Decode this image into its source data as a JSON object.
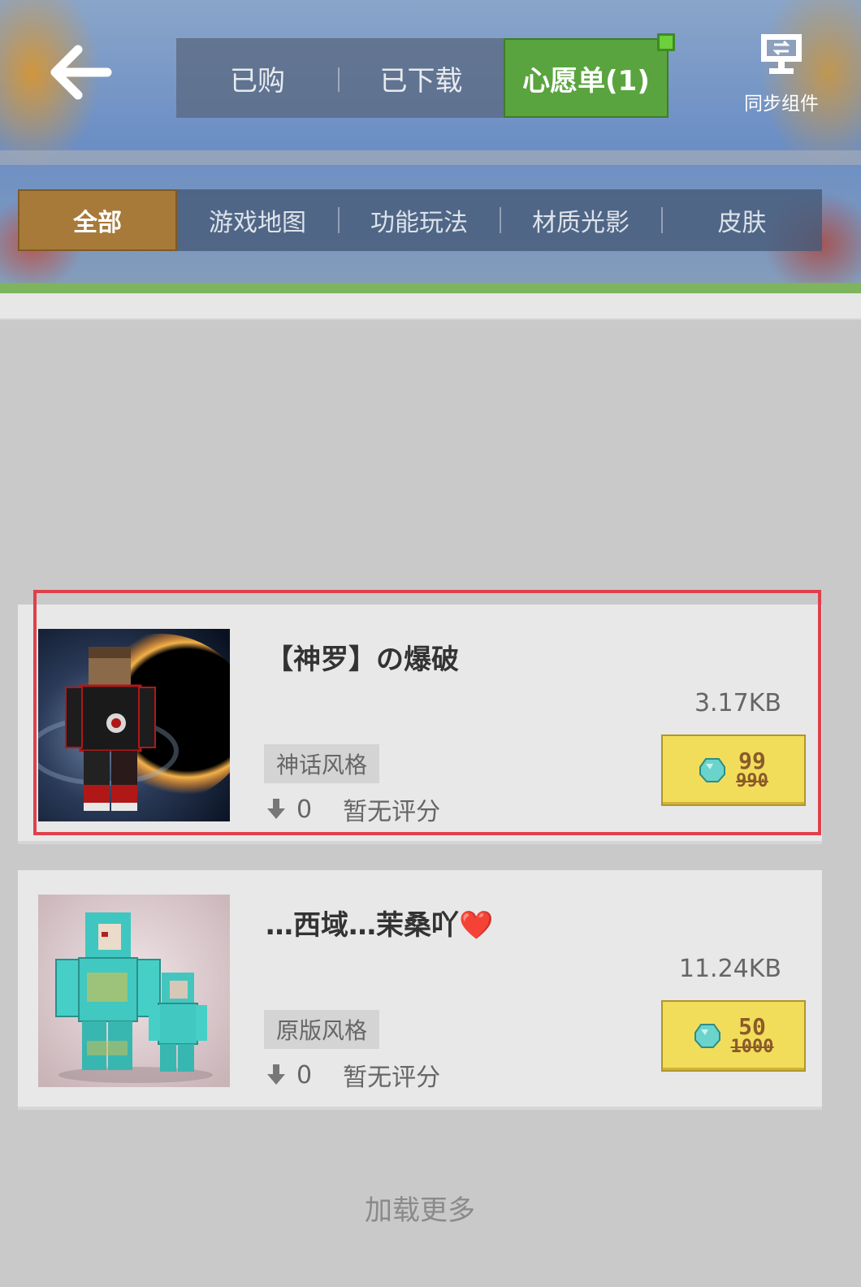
{
  "nav": {
    "back_icon": "arrow-left-icon",
    "tabs": [
      "已购",
      "已下载"
    ],
    "active_tab": "心愿单(1)",
    "sync_label": "同步组件",
    "sync_icon": "monitor-sync-icon"
  },
  "categories": {
    "active": "全部",
    "items": [
      "游戏地图",
      "功能玩法",
      "材质光影",
      "皮肤"
    ]
  },
  "items": [
    {
      "title": "【神罗】の爆破",
      "size": "3.17KB",
      "tag": "神话风格",
      "downloads": "0",
      "rating": "暂无评分",
      "price": "99",
      "original_price": "990",
      "currency_icon": "diamond-icon"
    },
    {
      "title": "…西域…茉桑吖❤️",
      "size": "11.24KB",
      "tag": "原版风格",
      "downloads": "0",
      "rating": "暂无评分",
      "price": "50",
      "original_price": "1000",
      "currency_icon": "diamond-icon"
    }
  ],
  "footer": {
    "load_more": "加载更多"
  },
  "colors": {
    "active_tab_green": "#5aa43f",
    "active_category_gold": "#a77a3a",
    "buy_button_yellow": "#f2dd5a",
    "highlight_red": "#e0404c"
  }
}
